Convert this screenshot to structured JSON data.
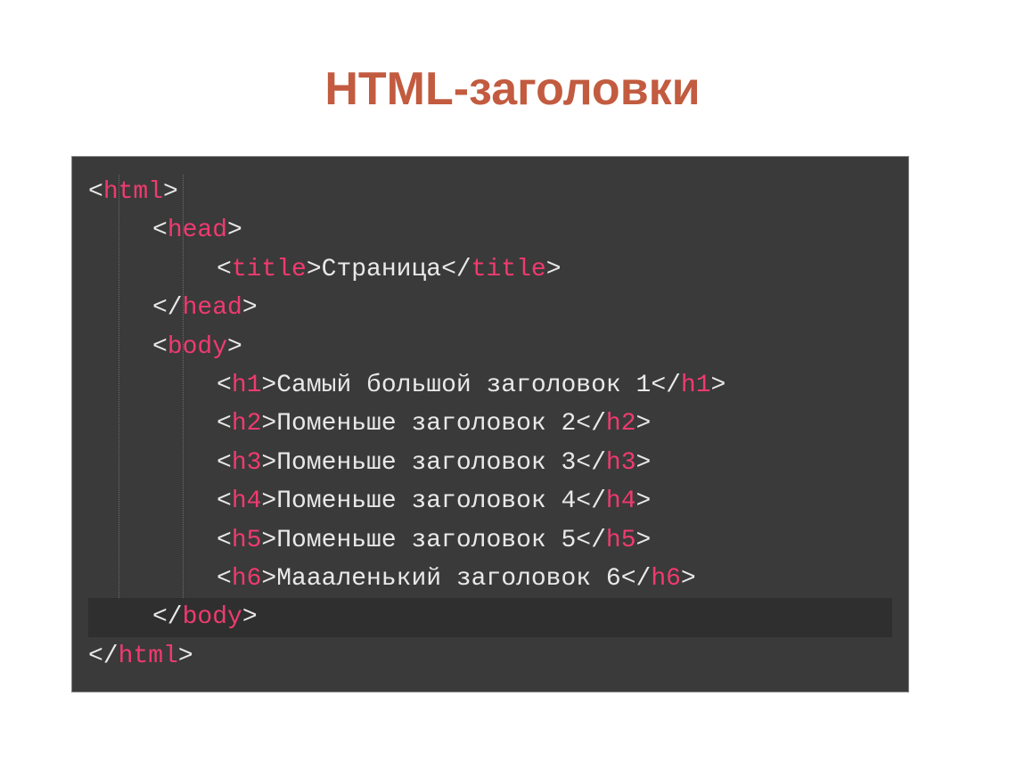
{
  "title": "HTML-заголовки",
  "code": {
    "tags": {
      "html": "html",
      "head": "head",
      "title": "title",
      "body": "body",
      "h1": "h1",
      "h2": "h2",
      "h3": "h3",
      "h4": "h4",
      "h5": "h5",
      "h6": "h6"
    },
    "text": {
      "title_inner": "Страница",
      "h1_inner": "Самый большой заголовок 1",
      "h2_inner": "Поменьше заголовок 2",
      "h3_inner": "Поменьше заголовок 3",
      "h4_inner": "Поменьше заголовок 4",
      "h5_inner": "Поменьше заголовок 5",
      "h6_inner": "Маааленький заголовок 6"
    }
  }
}
